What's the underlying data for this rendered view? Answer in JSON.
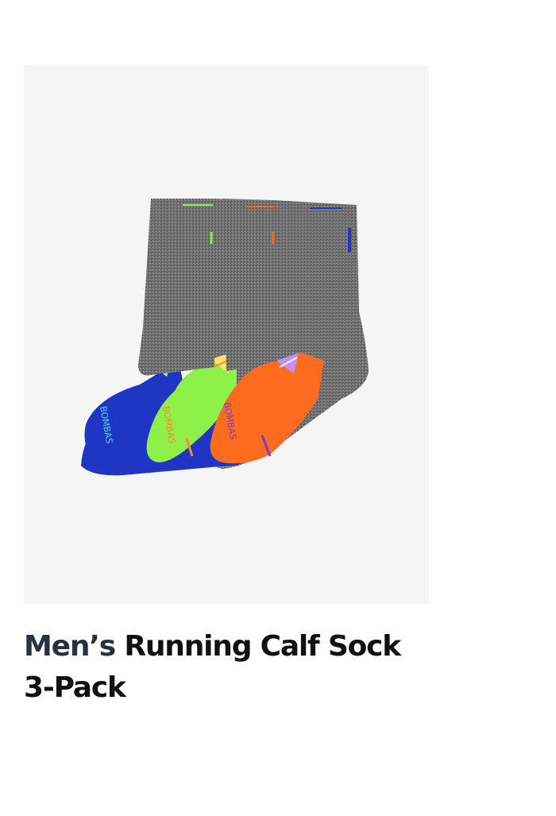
{
  "product": {
    "gender_label": "Men’s",
    "name": "Running Calf Sock 3-Pack",
    "image_alt": "Men’s Running Calf Sock 3-Pack",
    "brand_mark": "BOMBAS"
  },
  "colors": {
    "background": "#ffffff",
    "image_background": "#f4f5f4",
    "gender_text": "#273142",
    "title_text": "#111111",
    "sock_body": "#6e6e6e",
    "sock_blue": "#1f35c4",
    "sock_green": "#8ff04a",
    "sock_orange": "#ff6b1f"
  }
}
